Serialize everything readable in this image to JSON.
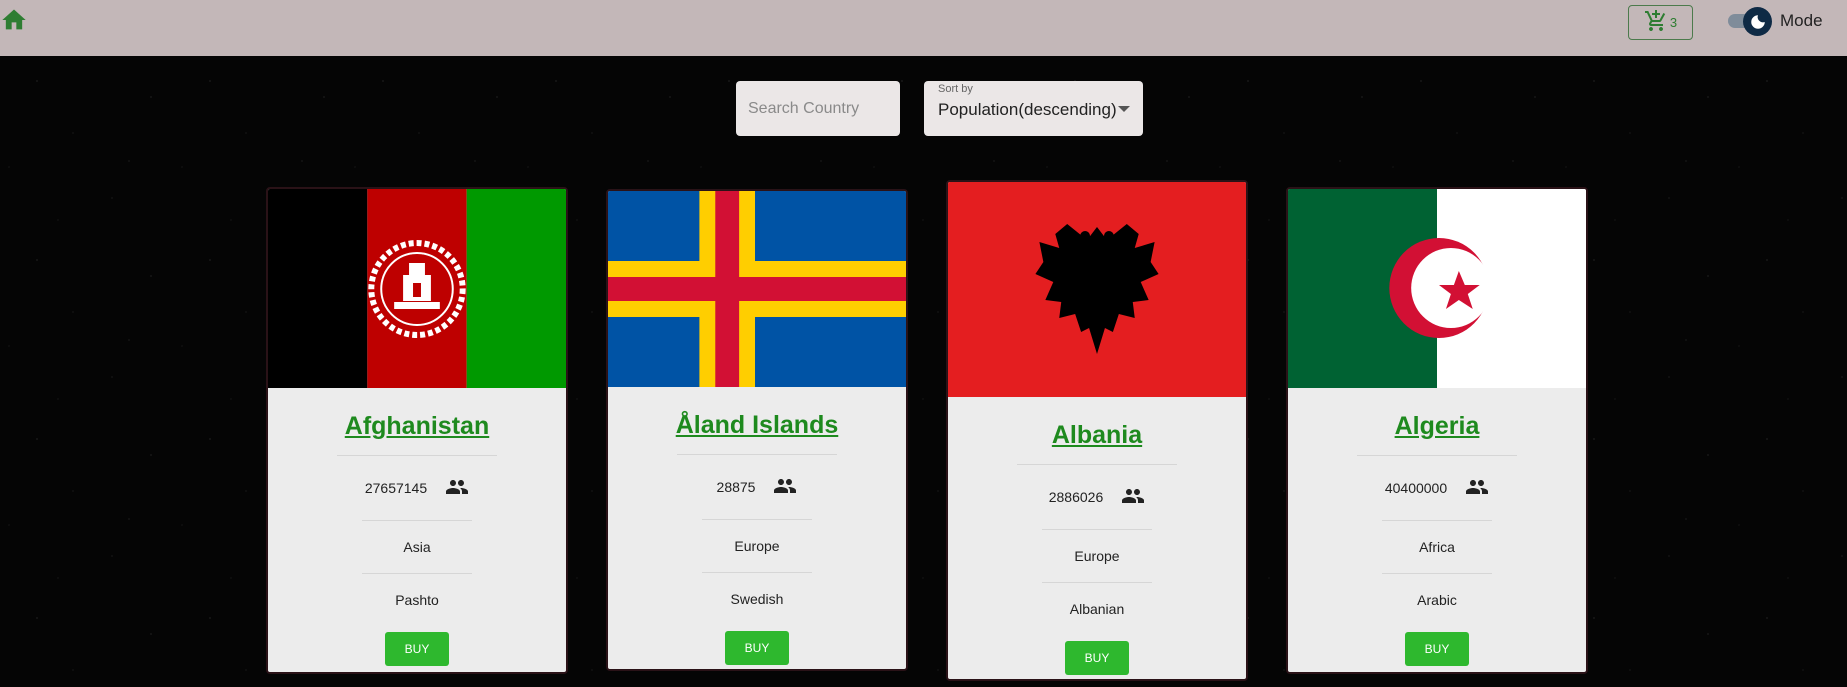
{
  "header": {
    "cart_count": "3",
    "mode_label": "Mode"
  },
  "controls": {
    "search_placeholder": "Search Country",
    "sort_label": "Sort by",
    "sort_value": "Population(descending)"
  },
  "countries": [
    {
      "name": "Afghanistan",
      "population": "27657145",
      "region": "Asia",
      "language": "Pashto",
      "buy_label": "BUY"
    },
    {
      "name": "Åland Islands",
      "population": "28875",
      "region": "Europe",
      "language": "Swedish",
      "buy_label": "BUY"
    },
    {
      "name": "Albania",
      "population": "2886026",
      "region": "Europe",
      "language": "Albanian",
      "buy_label": "BUY"
    },
    {
      "name": "Algeria",
      "population": "40400000",
      "region": "Africa",
      "language": "Arabic",
      "buy_label": "BUY"
    }
  ],
  "colors": {
    "accent_green": "#2eb82e",
    "link_green": "#1e8a1e",
    "topbar": "#c3b7b8",
    "card_bg": "#ececec"
  }
}
